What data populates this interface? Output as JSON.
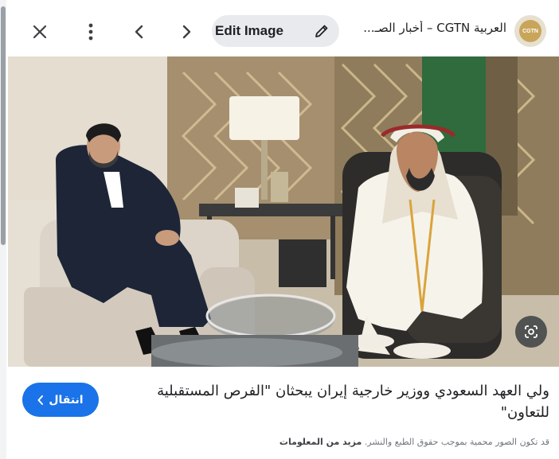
{
  "toolbar": {
    "close_icon": "close-icon",
    "more_icon": "more-vert-icon",
    "prev_icon": "chevron-left-icon",
    "next_icon": "chevron-right-icon",
    "edit_label": "Edit Image",
    "edit_icon": "pencil-icon"
  },
  "source": {
    "title": "العربية CGTN – أخبار الصـ...",
    "logo_text": "CGTN"
  },
  "image": {
    "description_icon": "lens-icon"
  },
  "result": {
    "caption": "ولي العهد السعودي ووزير خارجية إيران يبحثان \"الفرص المستقبلية للتعاون\"",
    "visit_label": "انتقال",
    "copyright_text": "قد تكون الصور محمية بموجب حقوق الطبع والنشر.",
    "more_info_label": "مزيد من المعلومات"
  },
  "colors": {
    "accent": "#1a73e8",
    "pill": "#e8eaed"
  }
}
